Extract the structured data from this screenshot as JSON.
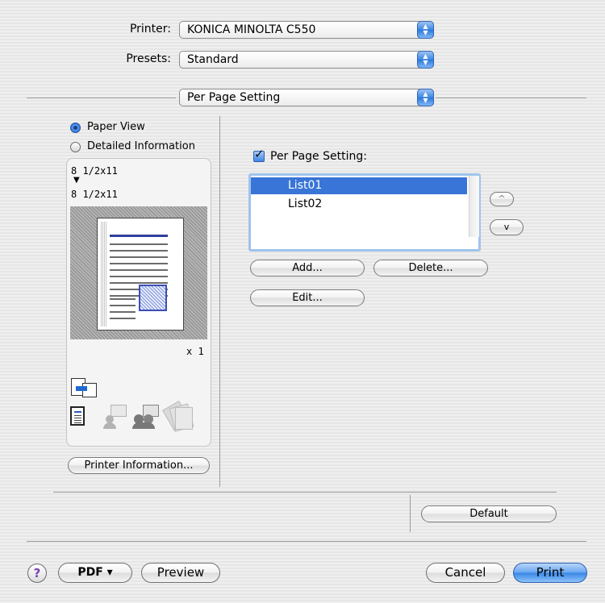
{
  "printer": {
    "label": "Printer:",
    "value": "KONICA MINOLTA C550"
  },
  "presets": {
    "label": "Presets:",
    "value": "Standard"
  },
  "panel_popup": {
    "value": "Per Page Setting"
  },
  "view_options": [
    {
      "label": "Paper View",
      "selected": true
    },
    {
      "label": "Detailed Information",
      "selected": false
    }
  ],
  "preview": {
    "paper_in": "8 1/2x11",
    "arrow": "▼",
    "paper_out": "8 1/2x11",
    "copies": "x 1"
  },
  "printer_info_button": "Printer Information...",
  "per_page": {
    "checkbox_label": "Per Page Setting:",
    "checked": true,
    "list": [
      {
        "label": "List01",
        "selected": true
      },
      {
        "label": "List02",
        "selected": false
      }
    ],
    "up_glyph": "^",
    "down_glyph": "v",
    "add_button": "Add...",
    "delete_button": "Delete...",
    "edit_button": "Edit..."
  },
  "default_button": "Default",
  "bottom_bar": {
    "help_glyph": "?",
    "pdf_button": "PDF ▾",
    "preview_button": "Preview",
    "cancel_button": "Cancel",
    "print_button": "Print"
  },
  "colors": {
    "accent": "#3875d7",
    "print_button": "#4b93ee"
  }
}
